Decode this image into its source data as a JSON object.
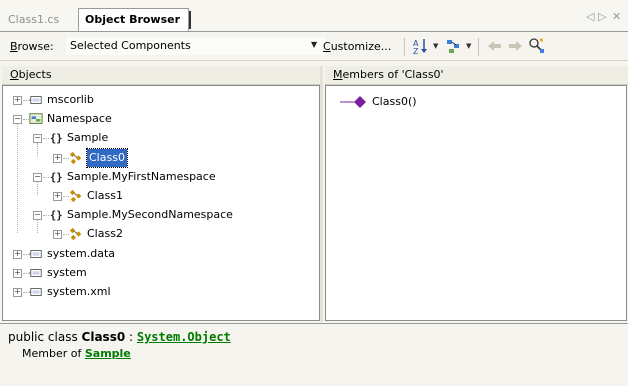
{
  "tabs": [
    {
      "label": "Class1.cs",
      "active": false
    },
    {
      "label": "Object Browser",
      "active": true
    }
  ],
  "tab_controls": {
    "prev": "◁",
    "next": "▷",
    "close": "✕"
  },
  "toolbar": {
    "browse_label_prefix": "B",
    "browse_label_rest": "rowse:",
    "browse_value": "Selected Components",
    "customize_prefix": "C",
    "customize_rest": "ustomize...",
    "icons": [
      "sort-icon",
      "group-icon",
      "go-back-icon",
      "go-forward-icon",
      "find-symbol-icon"
    ]
  },
  "objects_pane": {
    "header_prefix": "O",
    "header_rest": "bjects",
    "items": [
      {
        "label": "mscorlib",
        "icon": "assembly-icon",
        "expanded": false,
        "depth": 0
      },
      {
        "label": "Namespace",
        "icon": "project-icon",
        "expanded": true,
        "depth": 0
      },
      {
        "label": "Sample",
        "icon": "namespace-icon",
        "expanded": true,
        "depth": 1
      },
      {
        "label": "Class0",
        "icon": "class-icon",
        "expanded": false,
        "depth": 2,
        "selected": true
      },
      {
        "label": "Sample.MyFirstNamespace",
        "icon": "namespace-icon",
        "expanded": true,
        "depth": 1
      },
      {
        "label": "Class1",
        "icon": "class-icon",
        "expanded": false,
        "depth": 2
      },
      {
        "label": "Sample.MySecondNamespace",
        "icon": "namespace-icon",
        "expanded": true,
        "depth": 1
      },
      {
        "label": "Class2",
        "icon": "class-icon",
        "expanded": false,
        "depth": 2
      },
      {
        "label": "system.data",
        "icon": "assembly-icon",
        "expanded": false,
        "depth": 0
      },
      {
        "label": "system",
        "icon": "assembly-icon",
        "expanded": false,
        "depth": 0
      },
      {
        "label": "system.xml",
        "icon": "assembly-icon",
        "expanded": false,
        "depth": 0
      }
    ]
  },
  "members_pane": {
    "header_prefix": "M",
    "header_rest": "embers of 'Class0'",
    "items": [
      {
        "label": "Class0()",
        "icon": "method-icon"
      }
    ]
  },
  "description": {
    "prefix": "public class ",
    "class_name": "Class0",
    "separator": " : ",
    "base_type": "System.Object",
    "member_of_label": "Member of ",
    "member_of_link": "Sample"
  },
  "colors": {
    "selection": "#316ac5",
    "link": "#007a00",
    "method_icon": "#7a1fa2",
    "class_icon": "#c88a00"
  }
}
